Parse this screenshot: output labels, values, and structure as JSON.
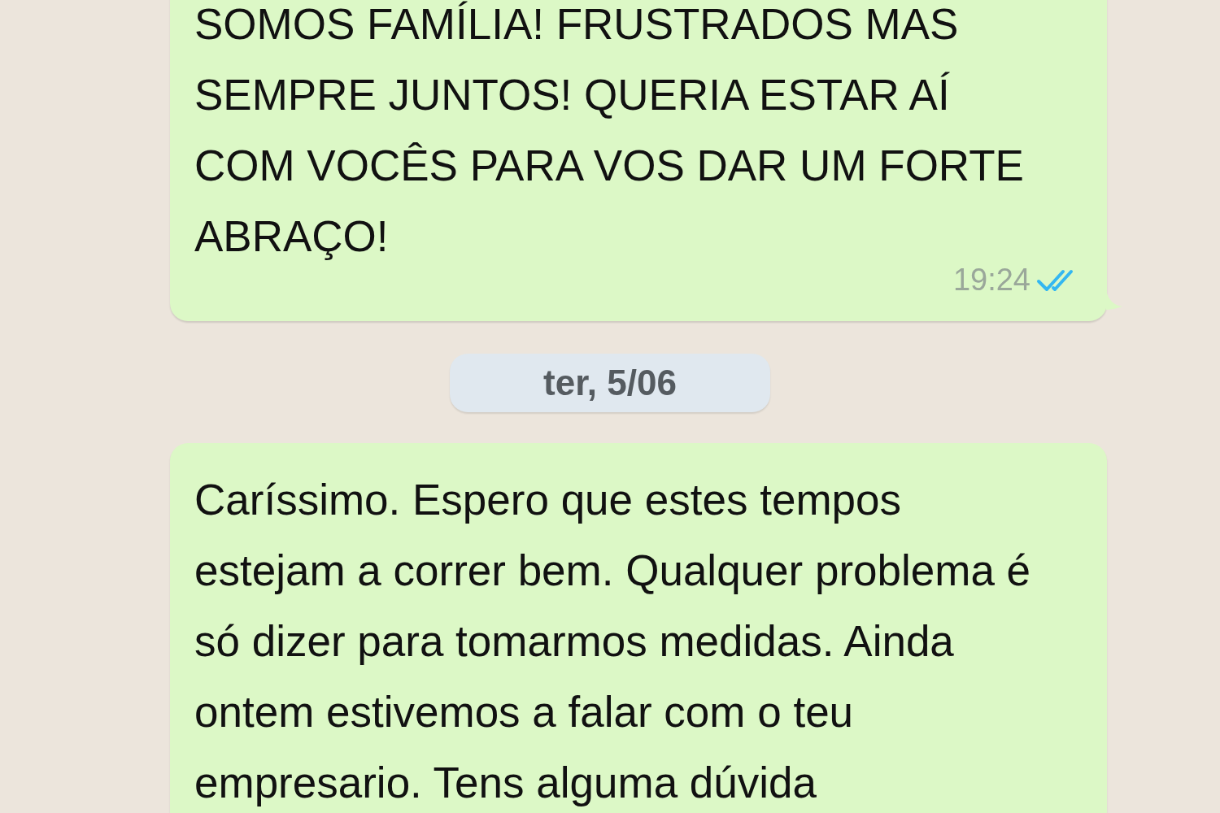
{
  "chat": [
    {
      "kind": "message",
      "text": "SOMOS FAMÍLIA! FRUSTRADOS MAS SEMPRE JUNTOS! QUERIA ESTAR AÍ COM VOCÊS PARA VOS DAR UM FORTE ABRAÇO!",
      "time": "19:24",
      "read": true,
      "tail": true
    },
    {
      "kind": "date",
      "text": "ter, 5/06"
    },
    {
      "kind": "message",
      "text": "Caríssimo. Espero que estes tempos estejam a correr bem. Qualquer problema é só dizer para tomarmos medidas. Ainda ontem estivemos a falar com o teu empresario. Tens alguma dúvida",
      "tail": false
    }
  ]
}
